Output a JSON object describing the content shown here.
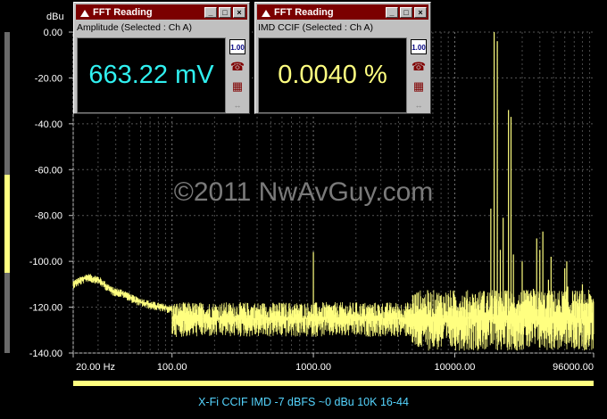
{
  "chart_data": {
    "type": "line",
    "ylabel": "dBu",
    "y_ticks": [
      "0.00",
      "-20.00",
      "-40.00",
      "-60.00",
      "-80.00",
      "-100.00",
      "-120.00",
      "-140.00"
    ],
    "ylim": [
      -140,
      0
    ],
    "x_scale": "log",
    "xlim": [
      20,
      96000
    ],
    "x_tick_labels": [
      {
        "value": 20,
        "label": "20.00 Hz"
      },
      {
        "value": 100,
        "label": "100.00"
      },
      {
        "value": 1000,
        "label": "1000.00"
      },
      {
        "value": 10000,
        "label": "10000.00"
      },
      {
        "value": 96000,
        "label": "96000.00"
      }
    ],
    "grid": true,
    "series_color": "#ffff80",
    "noise_floor_db": -125,
    "peaks": [
      {
        "x": 19000,
        "y": 0
      },
      {
        "x": 20000,
        "y": -4
      },
      {
        "x": 18000,
        "y": -77
      },
      {
        "x": 21000,
        "y": -95
      },
      {
        "x": 1000,
        "y": -96
      },
      {
        "x": 2000,
        "y": -118
      },
      {
        "x": 8000,
        "y": -115
      },
      {
        "x": 16000,
        "y": -113
      },
      {
        "x": 22000,
        "y": -81
      },
      {
        "x": 24000,
        "y": -34
      },
      {
        "x": 25000,
        "y": -37
      },
      {
        "x": 26000,
        "y": -97
      },
      {
        "x": 30000,
        "y": -100
      },
      {
        "x": 36000,
        "y": -112
      },
      {
        "x": 38000,
        "y": -90
      },
      {
        "x": 40000,
        "y": -95
      },
      {
        "x": 42000,
        "y": -87
      },
      {
        "x": 46000,
        "y": -108
      },
      {
        "x": 48000,
        "y": -98
      },
      {
        "x": 60000,
        "y": -103
      },
      {
        "x": 62000,
        "y": -100
      },
      {
        "x": 63000,
        "y": -111
      },
      {
        "x": 80000,
        "y": -110
      }
    ],
    "low_freq_floor": [
      {
        "x": 20,
        "y": -110
      },
      {
        "x": 25,
        "y": -107
      },
      {
        "x": 30,
        "y": -108
      },
      {
        "x": 38,
        "y": -113
      },
      {
        "x": 45,
        "y": -114
      },
      {
        "x": 55,
        "y": -117
      },
      {
        "x": 70,
        "y": -119
      },
      {
        "x": 100,
        "y": -121
      }
    ],
    "title": "X-Fi CCIF IMD -7 dBFS ~0 dBu 10K 16-44"
  },
  "watermark": "©2011 NwAvGuy.com",
  "windows": [
    {
      "title": "FFT Reading",
      "label": "Amplitude (Selected : Ch A)",
      "value": "663.22 mV",
      "value_color": "#30f0f0",
      "btn_label": "1.00"
    },
    {
      "title": "FFT Reading",
      "label": "IMD CCIF (Selected : Ch A)",
      "value": "0.0040 %",
      "value_color": "#ffff80",
      "btn_label": "1.00"
    }
  ]
}
